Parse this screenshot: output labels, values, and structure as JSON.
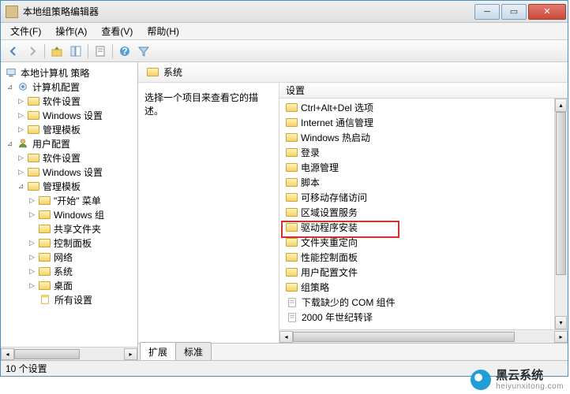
{
  "window": {
    "title": "本地组策略编辑器"
  },
  "menu": {
    "file": "文件(F)",
    "action": "操作(A)",
    "view": "查看(V)",
    "help": "帮助(H)"
  },
  "tree": {
    "root": "本地计算机 策略",
    "comp_config": "计算机配置",
    "software_settings": "软件设置",
    "windows_settings": "Windows 设置",
    "admin_templates": "管理模板",
    "user_config": "用户配置",
    "u_software": "软件设置",
    "u_windows": "Windows 设置",
    "u_admin": "管理模板",
    "start_menu": "\"开始\" 菜单",
    "windows_comp": "Windows 组",
    "shared_folders": "共享文件夹",
    "control_panel": "控制面板",
    "network": "网络",
    "system": "系统",
    "desktop": "桌面",
    "all_settings": "所有设置"
  },
  "right": {
    "header": "系统",
    "prompt": "选择一个项目来查看它的描述。",
    "col_setting": "设置",
    "items": [
      "Ctrl+Alt+Del 选项",
      "Internet 通信管理",
      "Windows 热启动",
      "登录",
      "电源管理",
      "脚本",
      "可移动存储访问",
      "区域设置服务",
      "驱动程序安装",
      "文件夹重定向",
      "性能控制面板",
      "用户配置文件",
      "组策略",
      "下载缺少的 COM 组件",
      "2000 年世纪转译"
    ]
  },
  "tabs": {
    "extended": "扩展",
    "standard": "标准"
  },
  "status": {
    "text": "10 个设置"
  },
  "watermark": {
    "t1": "黑云系统",
    "t2": "heiyunxitong.com"
  }
}
